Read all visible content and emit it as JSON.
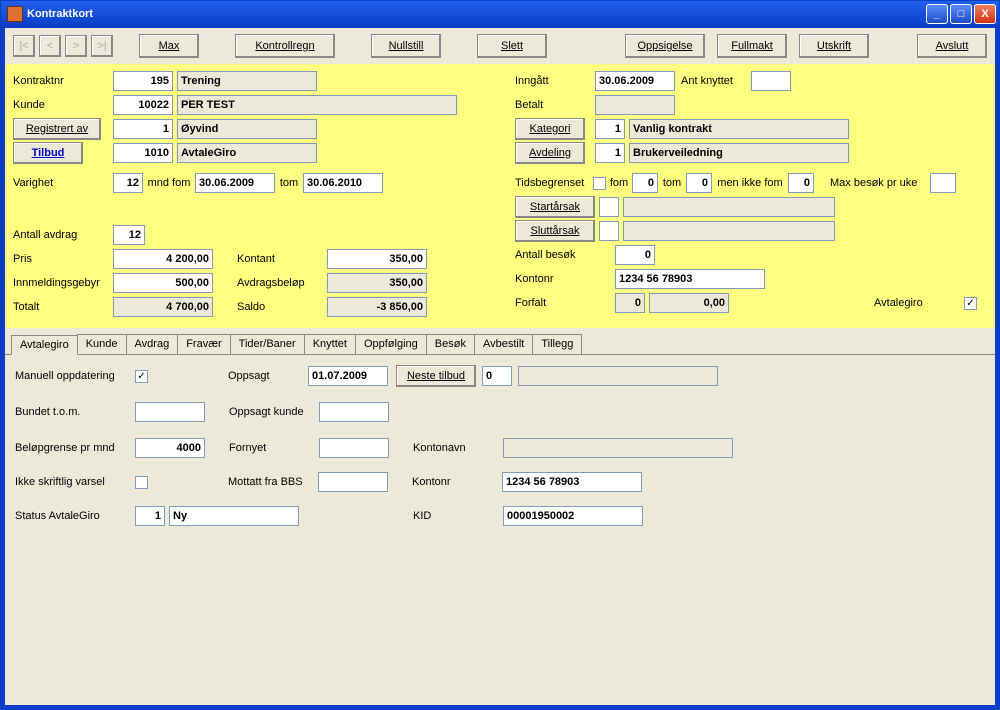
{
  "window": {
    "title": "Kontraktkort"
  },
  "nav": {
    "first": "|<",
    "prev": "<",
    "next": ">",
    "last": ">|"
  },
  "toolbar": {
    "max": "Max",
    "kontrollregn": "Kontrollregn",
    "nullstill": "Nullstill",
    "slett": "Slett",
    "oppsigelse": "Oppsigelse",
    "fullmakt": "Fullmakt",
    "utskrift": "Utskrift",
    "avslutt": "Avslutt"
  },
  "labels": {
    "kontraktnr": "Kontraktnr",
    "kunde": "Kunde",
    "registrert_av": "Registrert av",
    "tilbud": "Tilbud",
    "varighet": "Varighet",
    "mnd_fom": "mnd fom",
    "tom": "tom",
    "antall_avdrag": "Antall avdrag",
    "pris": "Pris",
    "innmeldingsgebyr": "Innmeldingsgebyr",
    "totalt": "Totalt",
    "kontant": "Kontant",
    "avdragsbelop": "Avdragsbeløp",
    "saldo": "Saldo",
    "inngatt": "Inngått",
    "ant_knyttet": "Ant knyttet",
    "betalt": "Betalt",
    "kategori": "Kategori",
    "avdeling": "Avdeling",
    "tidsbegrenset": "Tidsbegrenset",
    "fom": "fom",
    "men_ikke_fom": "men ikke fom",
    "max_besok": "Max besøk pr uke",
    "startarsak": "Startårsak",
    "sluttarsak": "Sluttårsak",
    "antall_besok": "Antall besøk",
    "kontonr": "Kontonr",
    "forfalt": "Forfalt",
    "avtalegiro": "Avtalegiro",
    "manuell": "Manuell oppdatering",
    "oppsagt": "Oppsagt",
    "neste_tilbud": "Neste tilbud",
    "bundet": "Bundet t.o.m.",
    "oppsagt_kunde": "Oppsagt kunde",
    "belop_grense": "Beløpgrense pr mnd",
    "fornyet": "Fornyet",
    "kontonavn": "Kontonavn",
    "ikke_skriftlig": "Ikke skriftlig varsel",
    "mottatt_bbs": "Mottatt fra BBS",
    "status_ag": "Status AvtaleGiro",
    "kid": "KID"
  },
  "values": {
    "kontraktnr": "195",
    "kontrakt_type": "Trening",
    "kundenr": "10022",
    "kundenavn": "PER TEST",
    "reg_nr": "1",
    "reg_navn": "Øyvind",
    "tilbud_nr": "1010",
    "tilbud_navn": "AvtaleGiro",
    "varighet_mnd": "12",
    "varighet_fom": "30.06.2009",
    "varighet_tom": "30.06.2010",
    "antall_avdrag": "12",
    "pris": "4 200,00",
    "kontant": "350,00",
    "innmelding": "500,00",
    "avdragsbelop": "350,00",
    "totalt": "4 700,00",
    "saldo": "-3 850,00",
    "inngatt": "30.06.2009",
    "ant_knyttet": "",
    "betalt": "",
    "kategori_nr": "1",
    "kategori_navn": "Vanlig kontrakt",
    "avdeling_nr": "1",
    "avdeling_navn": "Brukerveiledning",
    "tids_fom": "0",
    "tids_tom": "0",
    "tids_men": "0",
    "max_besok": "",
    "antall_besok": "0",
    "kontonr": "1234 56 78903",
    "forfalt_n": "0",
    "forfalt_sum": "0,00",
    "avtalegiro_checked": "✓",
    "manuell_checked": "✓",
    "oppsagt": "01.07.2009",
    "neste_tilbud_nr": "0",
    "neste_tilbud_txt": "",
    "bundet": "",
    "oppsagt_kunde": "",
    "belop_grense": "4000",
    "fornyet": "",
    "kontonavn": "",
    "mottatt_bbs": "",
    "kontonr2": "1234 56 78903",
    "status_nr": "1",
    "status_txt": "Ny",
    "kid": "00001950002"
  },
  "tabs": {
    "avtalegiro": "Avtalegiro",
    "kunde": "Kunde",
    "avdrag": "Avdrag",
    "fravaer": "Fravær",
    "tider": "Tider/Baner",
    "knyttet": "Knyttet",
    "oppfolging": "Oppfølging",
    "besok": "Besøk",
    "avbestilt": "Avbestilt",
    "tillegg": "Tillegg"
  }
}
